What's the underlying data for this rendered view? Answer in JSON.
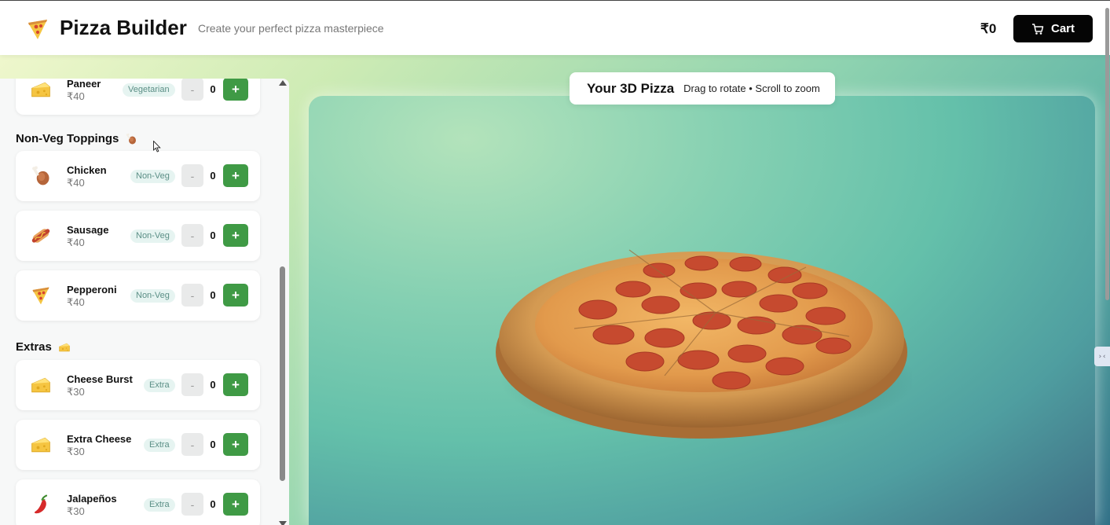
{
  "header": {
    "title": "Pizza Builder",
    "subtitle": "Create your perfect pizza masterpiece",
    "total": "₹0",
    "cart_label": "Cart",
    "logo_icon": "pizza-slice-icon",
    "cart_icon": "cart-icon"
  },
  "sidebar": {
    "top_item": {
      "name": "Paneer",
      "price": "₹40",
      "badge": "Vegetarian",
      "qty": "0",
      "icon": "cheese-icon"
    },
    "sections": [
      {
        "title": "Non-Veg Toppings",
        "icon": "drumstick-icon",
        "items": [
          {
            "name": "Chicken",
            "price": "₹40",
            "badge": "Non-Veg",
            "qty": "0",
            "icon": "drumstick-icon"
          },
          {
            "name": "Sausage",
            "price": "₹40",
            "badge": "Non-Veg",
            "qty": "0",
            "icon": "hotdog-icon"
          },
          {
            "name": "Pepperoni",
            "price": "₹40",
            "badge": "Non-Veg",
            "qty": "0",
            "icon": "pizza-slice-icon"
          }
        ]
      },
      {
        "title": "Extras",
        "icon": "cheese-icon",
        "items": [
          {
            "name": "Cheese Burst",
            "price": "₹30",
            "badge": "Extra",
            "qty": "0",
            "icon": "cheese-icon"
          },
          {
            "name": "Extra Cheese",
            "price": "₹30",
            "badge": "Extra",
            "qty": "0",
            "icon": "cheese-icon"
          },
          {
            "name": "Jalapeños",
            "price": "₹30",
            "badge": "Extra",
            "qty": "0",
            "icon": "hot-pepper-icon"
          }
        ]
      }
    ],
    "minus_label": "-",
    "plus_label": "+"
  },
  "viewer": {
    "title": "Your 3D Pizza",
    "hint": "Drag to rotate • Scroll to zoom"
  },
  "colors": {
    "accent_green": "#3f9a45",
    "cart_bg": "#050505",
    "badge_bg": "#e6f4f1"
  }
}
